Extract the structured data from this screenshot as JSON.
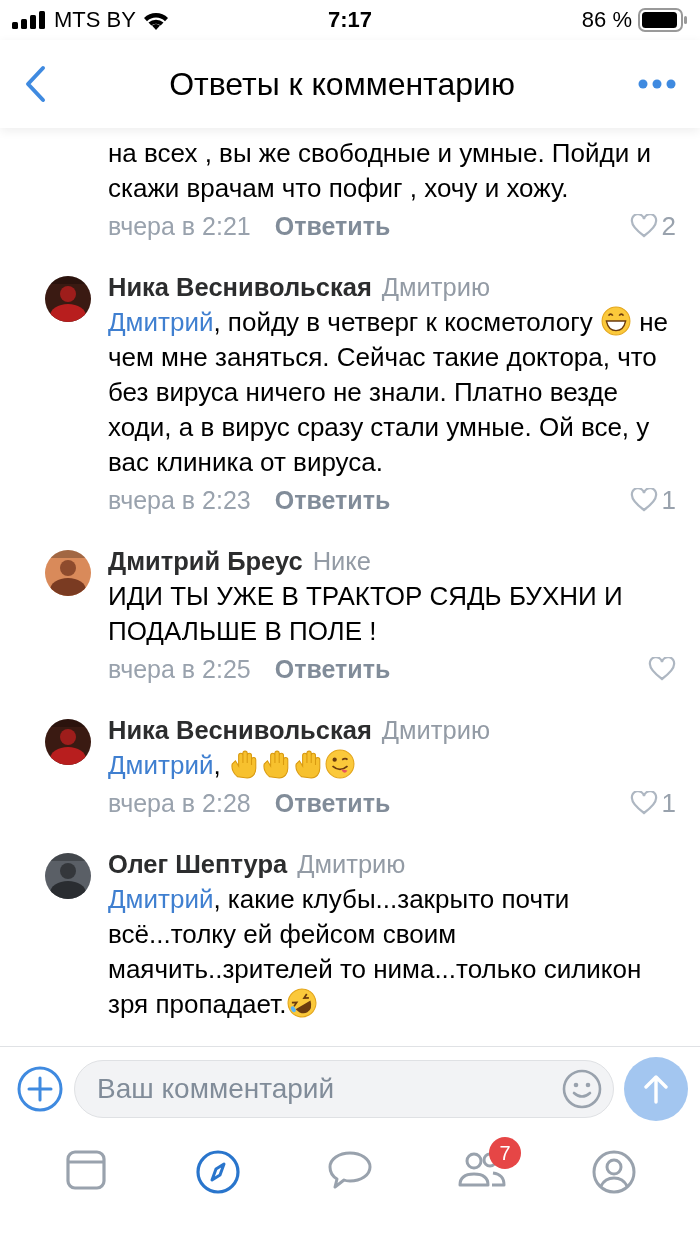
{
  "status_bar": {
    "carrier": "MTS BY",
    "time": "7:17",
    "battery": "86 %"
  },
  "header": {
    "title": "Ответы к комментарию"
  },
  "comments": [
    {
      "body": [
        {
          "kind": "text",
          "text": "на всех , вы же свободные и умные. Пойди и скажи врачам что пофиг , хочу и хожу."
        }
      ],
      "time": "вчера в 2:21",
      "reply": "Ответить",
      "likes": "2"
    },
    {
      "author": "Ника Веснивольская",
      "to": "Дмитрию",
      "mention": "Дмитрий",
      "body": [
        {
          "kind": "text",
          "text": ", пойду в четверг к косметологу "
        },
        {
          "kind": "grin"
        },
        {
          "kind": "text",
          "text": " не чем мне заняться. Сейчас такие доктора, что без вируса ничего не знали. Платно везде ходи, а в вирус сразу стали умные. Ой все, у вас клиника от вируса."
        }
      ],
      "time": "вчера в 2:23",
      "reply": "Ответить",
      "likes": "1"
    },
    {
      "author": "Дмитрий Бреус",
      "to": "Нике",
      "body": [
        {
          "kind": "text",
          "text": "ИДИ ТЫ УЖЕ В ТРАКТОР СЯДЬ БУХНИ И ПОДАЛЬШЕ В ПОЛЕ !"
        }
      ],
      "time": "вчера в 2:25",
      "reply": "Ответить"
    },
    {
      "author": "Ника Веснивольская",
      "to": "Дмитрию",
      "mention": "Дмитрий",
      "body": [
        {
          "kind": "text",
          "text": ", "
        },
        {
          "kind": "wave"
        },
        {
          "kind": "wave"
        },
        {
          "kind": "wave"
        },
        {
          "kind": "wink"
        }
      ],
      "time": "вчера в 2:28",
      "reply": "Ответить",
      "likes": "1"
    },
    {
      "author": "Олег Шептура",
      "to": "Дмитрию",
      "mention": "Дмитрий",
      "body": [
        {
          "kind": "text",
          "text": ", какие клубы...закрыто почти всё...толку ей фейсом своим маячить..зрителей то нима...только силикон зря пропадает."
        },
        {
          "kind": "rofl"
        }
      ]
    }
  ],
  "composer": {
    "placeholder": "Ваш комментарий"
  },
  "tab_bar": [
    {
      "selected": false
    },
    {
      "selected": true
    },
    {
      "selected": false
    },
    {
      "selected": false,
      "badge": "7"
    },
    {
      "selected": false
    }
  ]
}
